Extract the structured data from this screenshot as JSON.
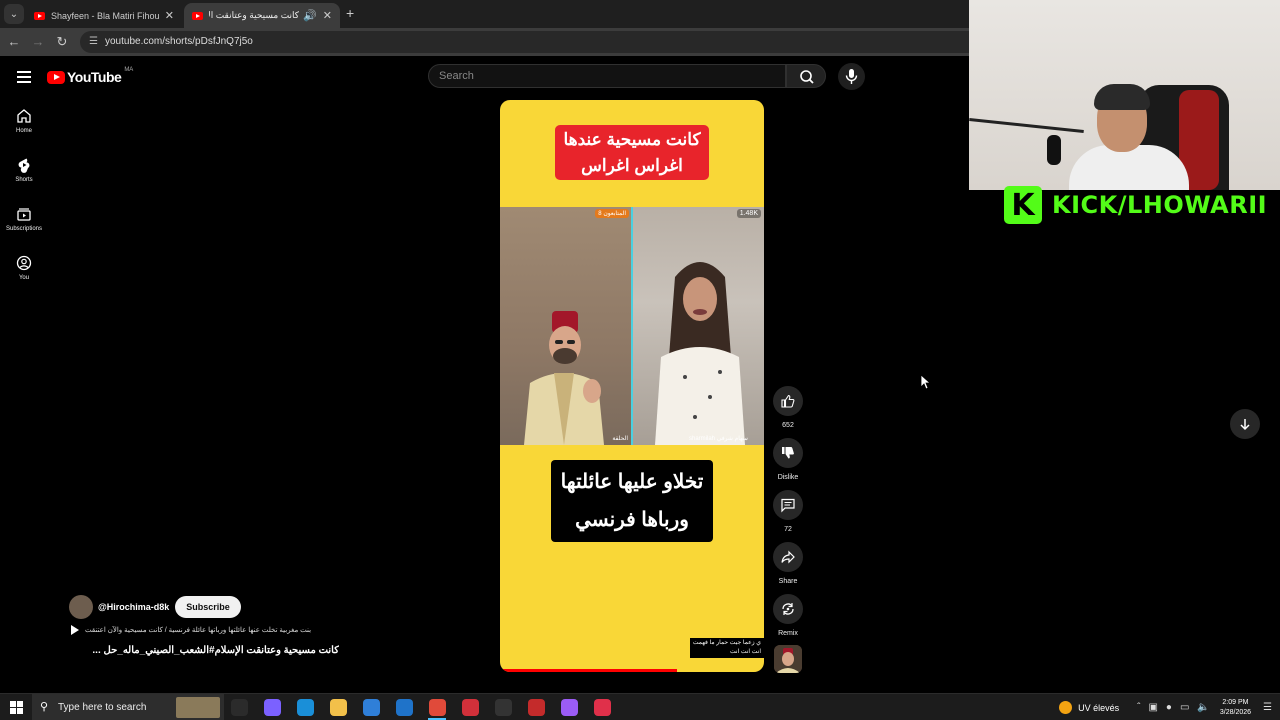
{
  "browser": {
    "tabs": [
      {
        "title": "Shayfeen - Bla Matiri Fihoum (Of",
        "active": false
      },
      {
        "title": "كانت مسيحية وعتانقت الإسلام",
        "active": true
      }
    ],
    "url": "youtube.com/shorts/pDsfJnQ7j5o"
  },
  "youtube": {
    "logo_text": "YouTube",
    "country_code": "MA",
    "search_placeholder": "Search",
    "guide": [
      {
        "label": "Home",
        "icon": "home-icon"
      },
      {
        "label": "Shorts",
        "icon": "shorts-icon"
      },
      {
        "label": "Subscriptions",
        "icon": "subscriptions-icon"
      },
      {
        "label": "You",
        "icon": "account-icon"
      }
    ]
  },
  "short": {
    "caption_top_lines": [
      "كانت مسيحية عندها",
      "اغراس اغراس"
    ],
    "caption_bottom_lines": [
      "تخلاو عليها عائلتها",
      "ورباها فرنسي"
    ],
    "tiny_caption_lines": [
      "ي زعما جيت حمار ما فهمت",
      "انت انت انت"
    ],
    "viewer_count": "1.48K",
    "left_badge": "8 المتابعون",
    "left_name": "الحلقة",
    "right_name": "sharmilah سهام شرفي",
    "channel": "@Hirochima-d8k",
    "subscribe_label": "Subscribe",
    "music_text": "بنت مغربية تخلت عنها عائلتها ورباتها عائلة فرنسية / كانت مسيحية والآن اعتنقت",
    "title": "كانت مسيحية وعتانقت الإسلام#الشعب_الصيني_ماله_حل ...",
    "progress_percent": 67
  },
  "actions": {
    "like_count": "652",
    "dislike_label": "Dislike",
    "comment_count": "72",
    "share_label": "Share",
    "remix_label": "Remix"
  },
  "overlay": {
    "kick_logo": "K",
    "kick_text": "KICK/LHOWARII"
  },
  "taskbar": {
    "search_placeholder": "Type here to search",
    "weather": "UV élevés",
    "time": "2:09 PM",
    "date": "3/28/2026",
    "apps": [
      {
        "name": "task-view-icon",
        "color": "#2b2b2b"
      },
      {
        "name": "copilot-icon",
        "color": "#7b61ff"
      },
      {
        "name": "edge-icon",
        "color": "#1a8fd8"
      },
      {
        "name": "file-explorer-icon",
        "color": "#f2c04a"
      },
      {
        "name": "store-icon",
        "color": "#2f7fd8"
      },
      {
        "name": "outlook-icon",
        "color": "#1f73c9"
      },
      {
        "name": "chrome-icon",
        "color": "#e04a3a"
      },
      {
        "name": "obs-icon",
        "color": "#d1303a"
      },
      {
        "name": "4k-app-icon",
        "color": "#333333"
      },
      {
        "name": "record-app-icon",
        "color": "#c42b2b"
      },
      {
        "name": "messenger-icon",
        "color": "#9b5cf5"
      },
      {
        "name": "capcut-icon",
        "color": "#e0304a"
      }
    ]
  }
}
